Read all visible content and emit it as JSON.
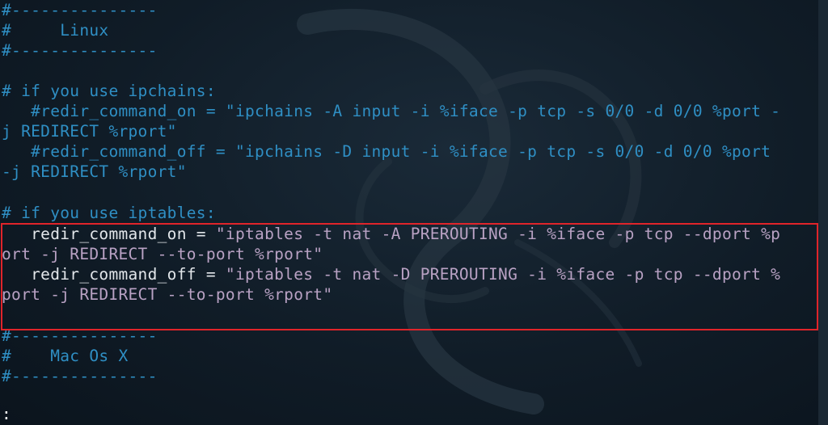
{
  "terminal": {
    "lines": [
      {
        "style": "comment",
        "text": "#---------------"
      },
      {
        "style": "comment",
        "text": "#     Linux"
      },
      {
        "style": "comment",
        "text": "#---------------"
      },
      {
        "style": "blank",
        "text": ""
      },
      {
        "style": "comment",
        "text": "# if you use ipchains:"
      },
      {
        "style": "comment",
        "text": "   #redir_command_on = \"ipchains -A input -i %iface -p tcp -s 0/0 -d 0/0 %port -"
      },
      {
        "style": "comment",
        "text": "j REDIRECT %rport\""
      },
      {
        "style": "comment",
        "text": "   #redir_command_off = \"ipchains -D input -i %iface -p tcp -s 0/0 -d 0/0 %port"
      },
      {
        "style": "comment",
        "text": "-j REDIRECT %rport\""
      },
      {
        "style": "blank",
        "text": ""
      },
      {
        "style": "comment",
        "text": "# if you use iptables:"
      },
      {
        "style": "code",
        "key": "   redir_command_on = ",
        "value": "\"iptables -t nat -A PREROUTING -i %iface -p tcp --dport %p"
      },
      {
        "style": "string",
        "text": "ort -j REDIRECT --to-port %rport\""
      },
      {
        "style": "code",
        "key": "   redir_command_off = ",
        "value": "\"iptables -t nat -D PREROUTING -i %iface -p tcp --dport %"
      },
      {
        "style": "string",
        "text": "port -j REDIRECT --to-port %rport\""
      },
      {
        "style": "blank",
        "text": ""
      },
      {
        "style": "comment",
        "text": "#---------------"
      },
      {
        "style": "comment",
        "text": "#    Mac Os X"
      },
      {
        "style": "comment",
        "text": "#---------------"
      },
      {
        "style": "blank",
        "text": ""
      },
      {
        "style": "cursor",
        "text": ":"
      }
    ]
  },
  "colors": {
    "comment": "#2f8fc4",
    "code": "#e2e6ea",
    "string": "#b9a2c4",
    "highlight_border": "#e0242a",
    "background": "#101c27"
  },
  "icons": {
    "watermark": "kali-dragon-icon"
  }
}
